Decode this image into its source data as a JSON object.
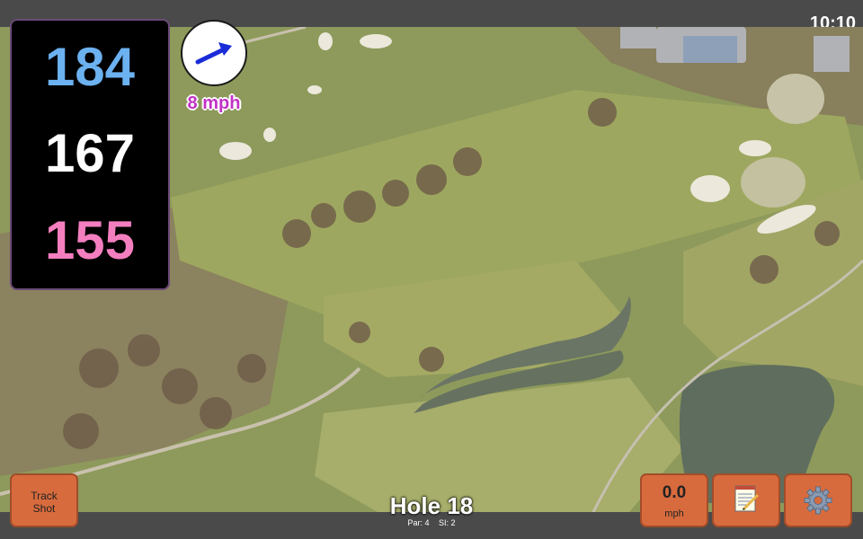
{
  "status_bar": {
    "time": "10:10"
  },
  "distances": {
    "back": "184",
    "middle": "167",
    "front": "155"
  },
  "wind": {
    "speed": "8 mph",
    "icon": "wind-arrow-icon"
  },
  "controls": {
    "track_shot_label": "Track\nShot",
    "speed_value": "0.0",
    "speed_unit": "mph",
    "notes_icon": "notepad-icon",
    "settings_icon": "gear-icon"
  },
  "hole": {
    "title": "Hole 18",
    "par": "Par: 4",
    "stroke_index": "SI: 2"
  },
  "colors": {
    "back": "#6cb1f0",
    "middle": "#ffffff",
    "front": "#f47fbf",
    "button": "#d86b3d",
    "wind_text": "#c232c6"
  }
}
